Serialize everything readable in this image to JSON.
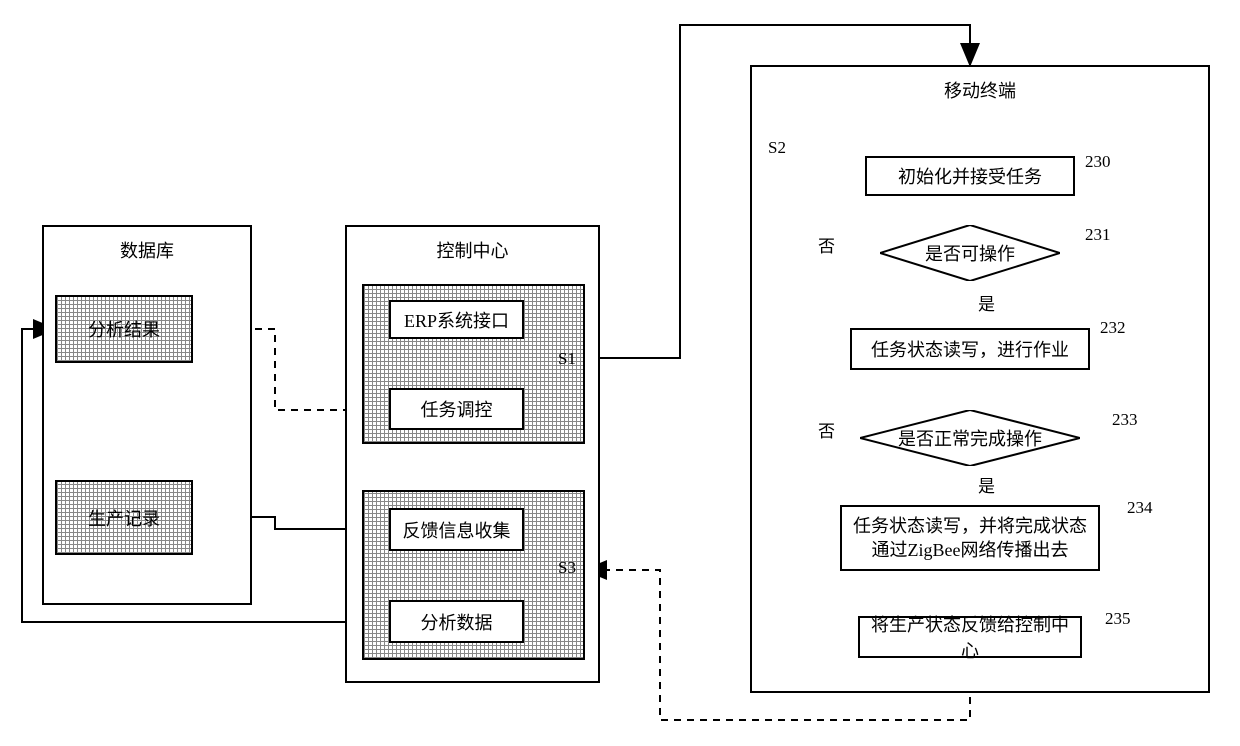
{
  "database": {
    "title": "数据库",
    "box1": "分析结果",
    "box2": "生产记录"
  },
  "control": {
    "title": "控制中心",
    "s1": {
      "tag": "S1",
      "top": "ERP系统接口",
      "bottom": "任务调控"
    },
    "s3": {
      "tag": "S3",
      "top": "反馈信息收集",
      "bottom": "分析数据"
    }
  },
  "mobile": {
    "title": "移动终端",
    "tag": "S2",
    "steps": {
      "n230": {
        "num": "230",
        "text": "初始化并接受任务"
      },
      "n231": {
        "num": "231",
        "text": "是否可操作",
        "yes": "是",
        "no": "否"
      },
      "n232": {
        "num": "232",
        "text": "任务状态读写，进行作业"
      },
      "n233": {
        "num": "233",
        "text": "是否正常完成操作",
        "yes": "是",
        "no": "否"
      },
      "n234": {
        "num": "234",
        "text": "任务状态读写，并将完成状态通过ZigBee网络传播出去"
      },
      "n235": {
        "num": "235",
        "text": "将生产状态反馈给控制中心"
      }
    }
  }
}
